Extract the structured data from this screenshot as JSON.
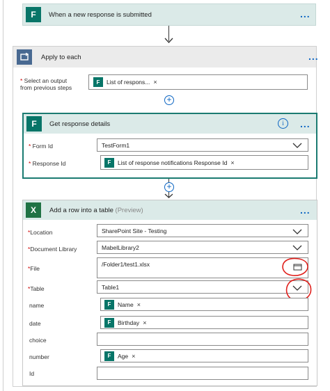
{
  "trigger": {
    "title": "When a new response is submitted",
    "icon": "forms-icon",
    "more": "..."
  },
  "apply_each": {
    "title": "Apply to each",
    "icon": "loop-icon",
    "more": "...",
    "select_label_line1": "Select an output",
    "select_label_line2": "from previous steps",
    "select_token": "List of respons...",
    "token_remove": "×"
  },
  "get_response": {
    "title": "Get response details",
    "info": "i",
    "more": "...",
    "form_id_label": "Form Id",
    "form_id_value": "TestForm1",
    "response_id_label": "Response Id",
    "response_id_token": "List of response notifications Response Id",
    "token_remove": "×"
  },
  "add_row": {
    "title": "Add a row into a table",
    "preview": "(Preview)",
    "more": "...",
    "fields": {
      "location_label": "Location",
      "location_value": "SharePoint Site - Testing",
      "doclib_label": "Document Library",
      "doclib_value": "MabelLibrary2",
      "file_label": "File",
      "file_value": "/Folder1/test1.xlsx",
      "table_label": "Table",
      "table_value": "Table1",
      "name_label": "name",
      "name_token": "Name",
      "date_label": "date",
      "date_token": "Birthday",
      "choice_label": "choice",
      "number_label": "number",
      "number_token": "Age",
      "id_label": "Id"
    },
    "token_remove": "×"
  },
  "colors": {
    "forms_green": "#077568",
    "excel_green": "#1f7244",
    "loop_blue": "#486991",
    "header_teal": "#d9ebe8",
    "link_blue": "#0a64c2",
    "annotation_red": "#e0201c"
  }
}
